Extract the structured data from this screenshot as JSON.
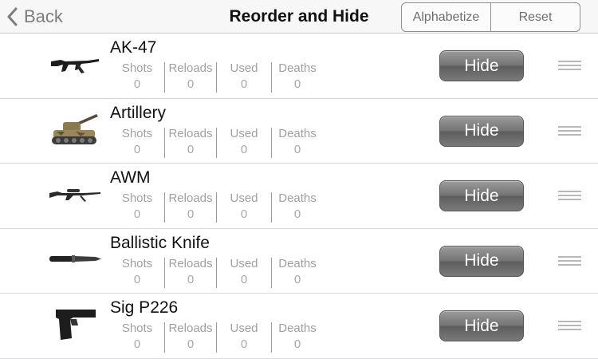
{
  "navbar": {
    "back_label": "Back",
    "title": "Reorder and Hide",
    "segments": [
      "Alphabetize",
      "Reset"
    ]
  },
  "stat_labels": [
    "Shots",
    "Reloads",
    "Used",
    "Deaths"
  ],
  "hide_label": "Hide",
  "weapons": [
    {
      "name": "AK-47",
      "icon": "rifle-icon",
      "stats": [
        "0",
        "0",
        "0",
        "0"
      ]
    },
    {
      "name": "Artillery",
      "icon": "tank-icon",
      "stats": [
        "0",
        "0",
        "0",
        "0"
      ]
    },
    {
      "name": "AWM",
      "icon": "sniper-rifle-icon",
      "stats": [
        "0",
        "0",
        "0",
        "0"
      ]
    },
    {
      "name": "Ballistic Knife",
      "icon": "knife-icon",
      "stats": [
        "0",
        "0",
        "0",
        "0"
      ]
    },
    {
      "name": "Sig P226",
      "icon": "pistol-icon",
      "stats": [
        "0",
        "0",
        "0",
        "0"
      ]
    }
  ]
}
